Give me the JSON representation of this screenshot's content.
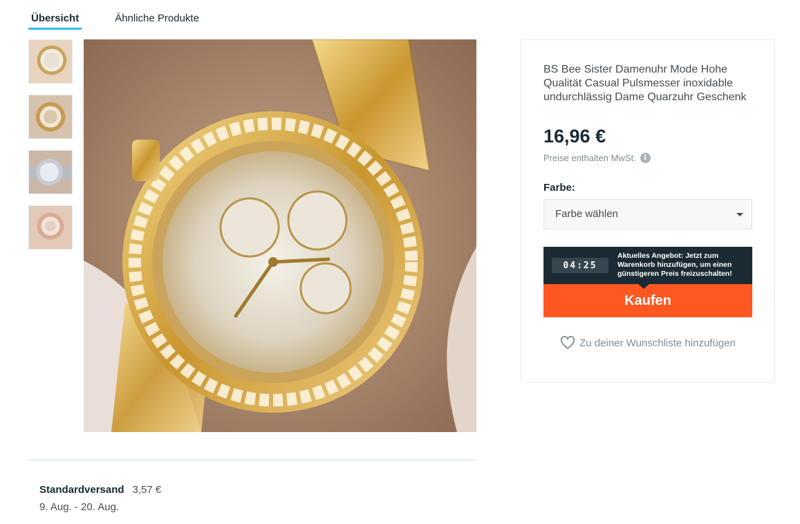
{
  "tabs": [
    {
      "label": "Übersicht",
      "active": true
    },
    {
      "label": "Ähnliche Produkte",
      "active": false
    }
  ],
  "product": {
    "title": "BS Bee Sister Damenuhr Mode Hohe Qualität Casual Pulsmesser inoxidable undurchlässig Dame Quarzuhr Geschenk",
    "price": "16,96 €",
    "vat_note": "Preise enthalten MwSt.",
    "info_icon": "i"
  },
  "variant": {
    "label": "Farbe:",
    "selected": "Farbe wählen"
  },
  "offer": {
    "timer": "04:25",
    "text": "Aktuelles Angebot: Jetzt zum Warenkorb hinzufügen, um einen günstigeren Preis freizuschalten!"
  },
  "buy_label": "Kaufen",
  "wishlist_label": "Zu deiner Wunschliste hinzufügen",
  "shipping": {
    "label": "Standardversand",
    "price": "3,57 €",
    "dates": "9. Aug. - 20. Aug."
  },
  "colors": {
    "accent_tab": "#2fb7ec",
    "buy_button": "#ff5722",
    "offer_bg": "#1c2b33"
  }
}
